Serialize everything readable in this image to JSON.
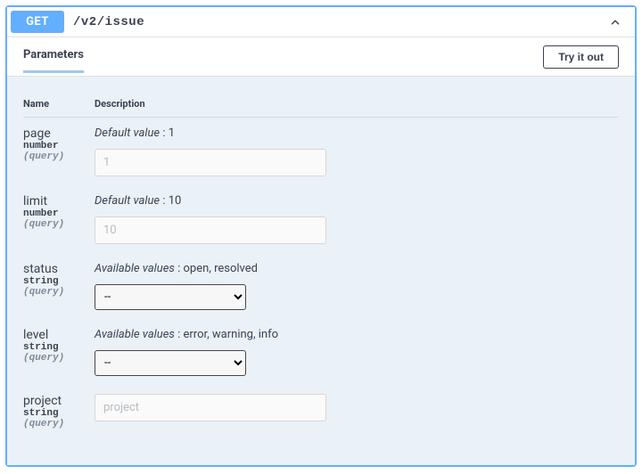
{
  "method": "GET",
  "path": "/v2/issue",
  "sections": {
    "parameters_title": "Parameters",
    "try_button": "Try it out"
  },
  "headers": {
    "name": "Name",
    "description": "Description"
  },
  "labels": {
    "default_value": "Default value",
    "available_values": "Available values"
  },
  "params": {
    "page": {
      "name": "page",
      "type": "number",
      "in": "(query)",
      "default": "1",
      "placeholder": "1"
    },
    "limit": {
      "name": "limit",
      "type": "number",
      "in": "(query)",
      "default": "10",
      "placeholder": "10"
    },
    "status": {
      "name": "status",
      "type": "string",
      "in": "(query)",
      "values": "open, resolved",
      "selected": "--"
    },
    "level": {
      "name": "level",
      "type": "string",
      "in": "(query)",
      "values": "error, warning, info",
      "selected": "--"
    },
    "project": {
      "name": "project",
      "type": "string",
      "in": "(query)",
      "placeholder": "project"
    }
  }
}
